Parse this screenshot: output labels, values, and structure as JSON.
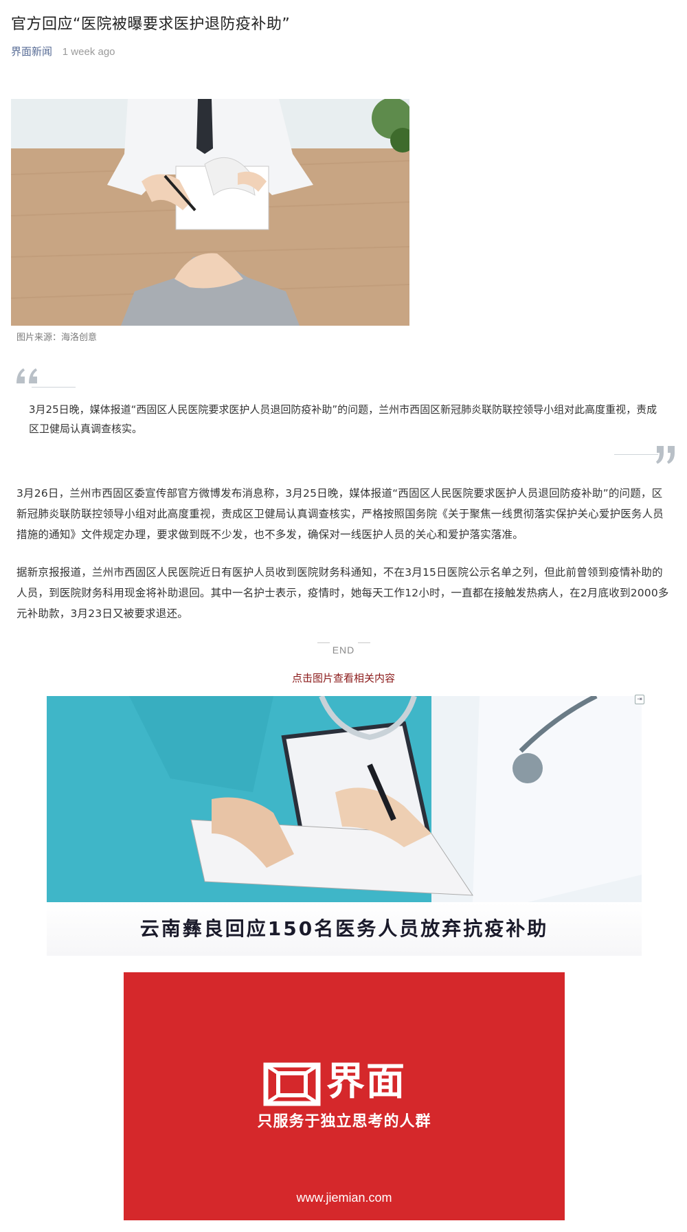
{
  "article": {
    "title": "官方回应“医院被曝要求医护退防疫补助”",
    "source": "界面新闻",
    "time": "1 week ago"
  },
  "hero": {
    "caption": "图片来源：海洛创意"
  },
  "quote": {
    "text": "3月25日晚，媒体报道“西固区人民医院要求医护人员退回防疫补助”的问题，兰州市西固区新冠肺炎联防联控领导小组对此高度重视，责成区卫健局认真调查核实。"
  },
  "paragraphs": [
    "3月26日，兰州市西固区委宣传部官方微博发布消息称，3月25日晚，媒体报道“西固区人民医院要求医护人员退回防疫补助”的问题，区新冠肺炎联防联控领导小组对此高度重视，责成区卫健局认真调查核实，严格按照国务院《关于聚焦一线贯彻落实保护关心爱护医务人员措施的通知》文件规定办理，要求做到既不少发，也不多发，确保对一线医护人员的关心和爱护落实落准。",
    "据新京报报道，兰州市西固区人民医院近日有医护人员收到医院财务科通知，不在3月15日医院公示名单之列，但此前曾领到疫情补助的人员，到医院财务科用现金将补助退回。其中一名护士表示，疫情时，她每天工作12小时，一直都在接触发热病人，在2月底收到2000多元补助款，3月23日又被要求退还。"
  ],
  "end": {
    "label": "END"
  },
  "related": {
    "link_text": "点击图片查看相关内容",
    "headline": "云南彝良回应150名医务人员放弃抗疫补助"
  },
  "brand": {
    "name": "界面",
    "slogan": "只服务于独立思考的人群",
    "url": "www.jiemian.com",
    "color": "#d5282b"
  },
  "icons": {
    "quote_open": "quote-open-icon",
    "quote_close": "quote-close-icon",
    "ad_badge": "ad-badge-icon",
    "brand_logo": "jiemian-logo-icon"
  }
}
